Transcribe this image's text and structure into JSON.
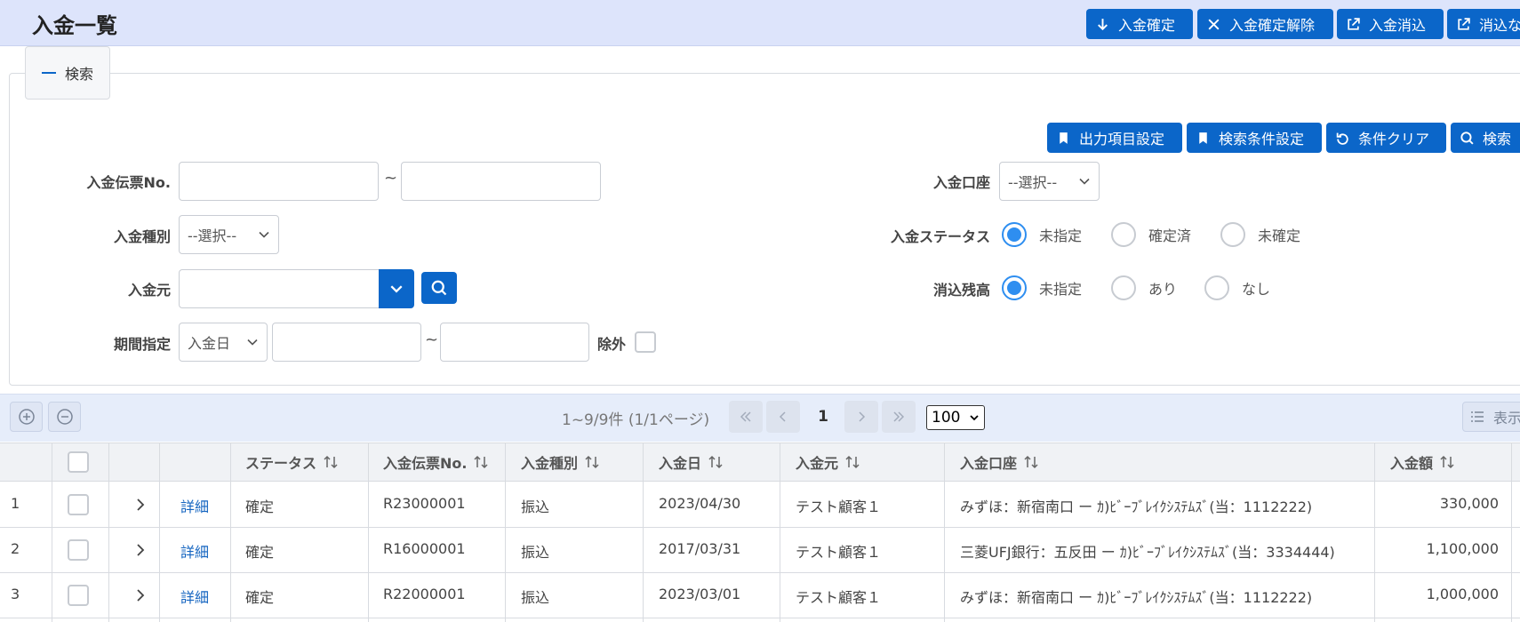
{
  "header": {
    "title": "入金一覧",
    "buttons": [
      {
        "label": "入金確定"
      },
      {
        "label": "入金確定解除"
      },
      {
        "label": "入金消込"
      },
      {
        "label": "消込な"
      }
    ]
  },
  "search": {
    "tab_label": "検索",
    "buttons": [
      {
        "label": "出力項目設定"
      },
      {
        "label": "検索条件設定"
      },
      {
        "label": "条件クリア"
      },
      {
        "label": "検索"
      }
    ],
    "fields": {
      "slip_no": {
        "label": "入金伝票No.",
        "from": "",
        "to": "",
        "sep": "~"
      },
      "account": {
        "label": "入金口座",
        "value": "--選択--"
      },
      "type": {
        "label": "入金種別",
        "value": "--選択--"
      },
      "status": {
        "label": "入金ステータス",
        "options": [
          "未指定",
          "確定済",
          "未確定"
        ],
        "selected": 0
      },
      "payer": {
        "label": "入金元",
        "value": ""
      },
      "balance": {
        "label": "消込残高",
        "options": [
          "未指定",
          "あり",
          "なし"
        ],
        "selected": 0
      },
      "period": {
        "label": "期間指定",
        "type_value": "入金日",
        "from": "",
        "to": "",
        "sep": "~",
        "exclude_label": "除外"
      }
    }
  },
  "pagination": {
    "summary": "1~9/9件 (1/1ページ)",
    "current_page": "1",
    "page_size": "100",
    "display_label": "表示"
  },
  "table": {
    "columns": [
      "ステータス",
      "入金伝票No.",
      "入金種別",
      "入金日",
      "入金元",
      "入金口座",
      "入金額"
    ],
    "detail_label": "詳細",
    "rows": [
      {
        "no": "1",
        "status": "確定",
        "slip_no": "R23000001",
        "type": "振込",
        "date": "2023/04/30",
        "payer": "テスト顧客１",
        "account": "みずほ：新宿南口 ー ｶ)ﾋﾞｰﾌﾞﾚｲｸｼｽﾃﾑｽﾞ(当：1112222)",
        "amount": "330,000"
      },
      {
        "no": "2",
        "status": "確定",
        "slip_no": "R16000001",
        "type": "振込",
        "date": "2017/03/31",
        "payer": "テスト顧客１",
        "account": "三菱UFJ銀行：五反田 ー ｶ)ﾋﾞｰﾌﾞﾚｲｸｼｽﾃﾑｽﾞ(当：3334444)",
        "amount": "1,100,000"
      },
      {
        "no": "3",
        "status": "確定",
        "slip_no": "R22000001",
        "type": "振込",
        "date": "2023/03/01",
        "payer": "テスト顧客１",
        "account": "みずほ：新宿南口 ー ｶ)ﾋﾞｰﾌﾞﾚｲｸｼｽﾃﾑｽﾞ(当：1112222)",
        "amount": "1,000,000"
      }
    ]
  },
  "colors": {
    "primary": "#0b66c9",
    "header_bg": "#dde4fb",
    "radio_on": "#2e8ef0",
    "link": "#1565c0"
  }
}
